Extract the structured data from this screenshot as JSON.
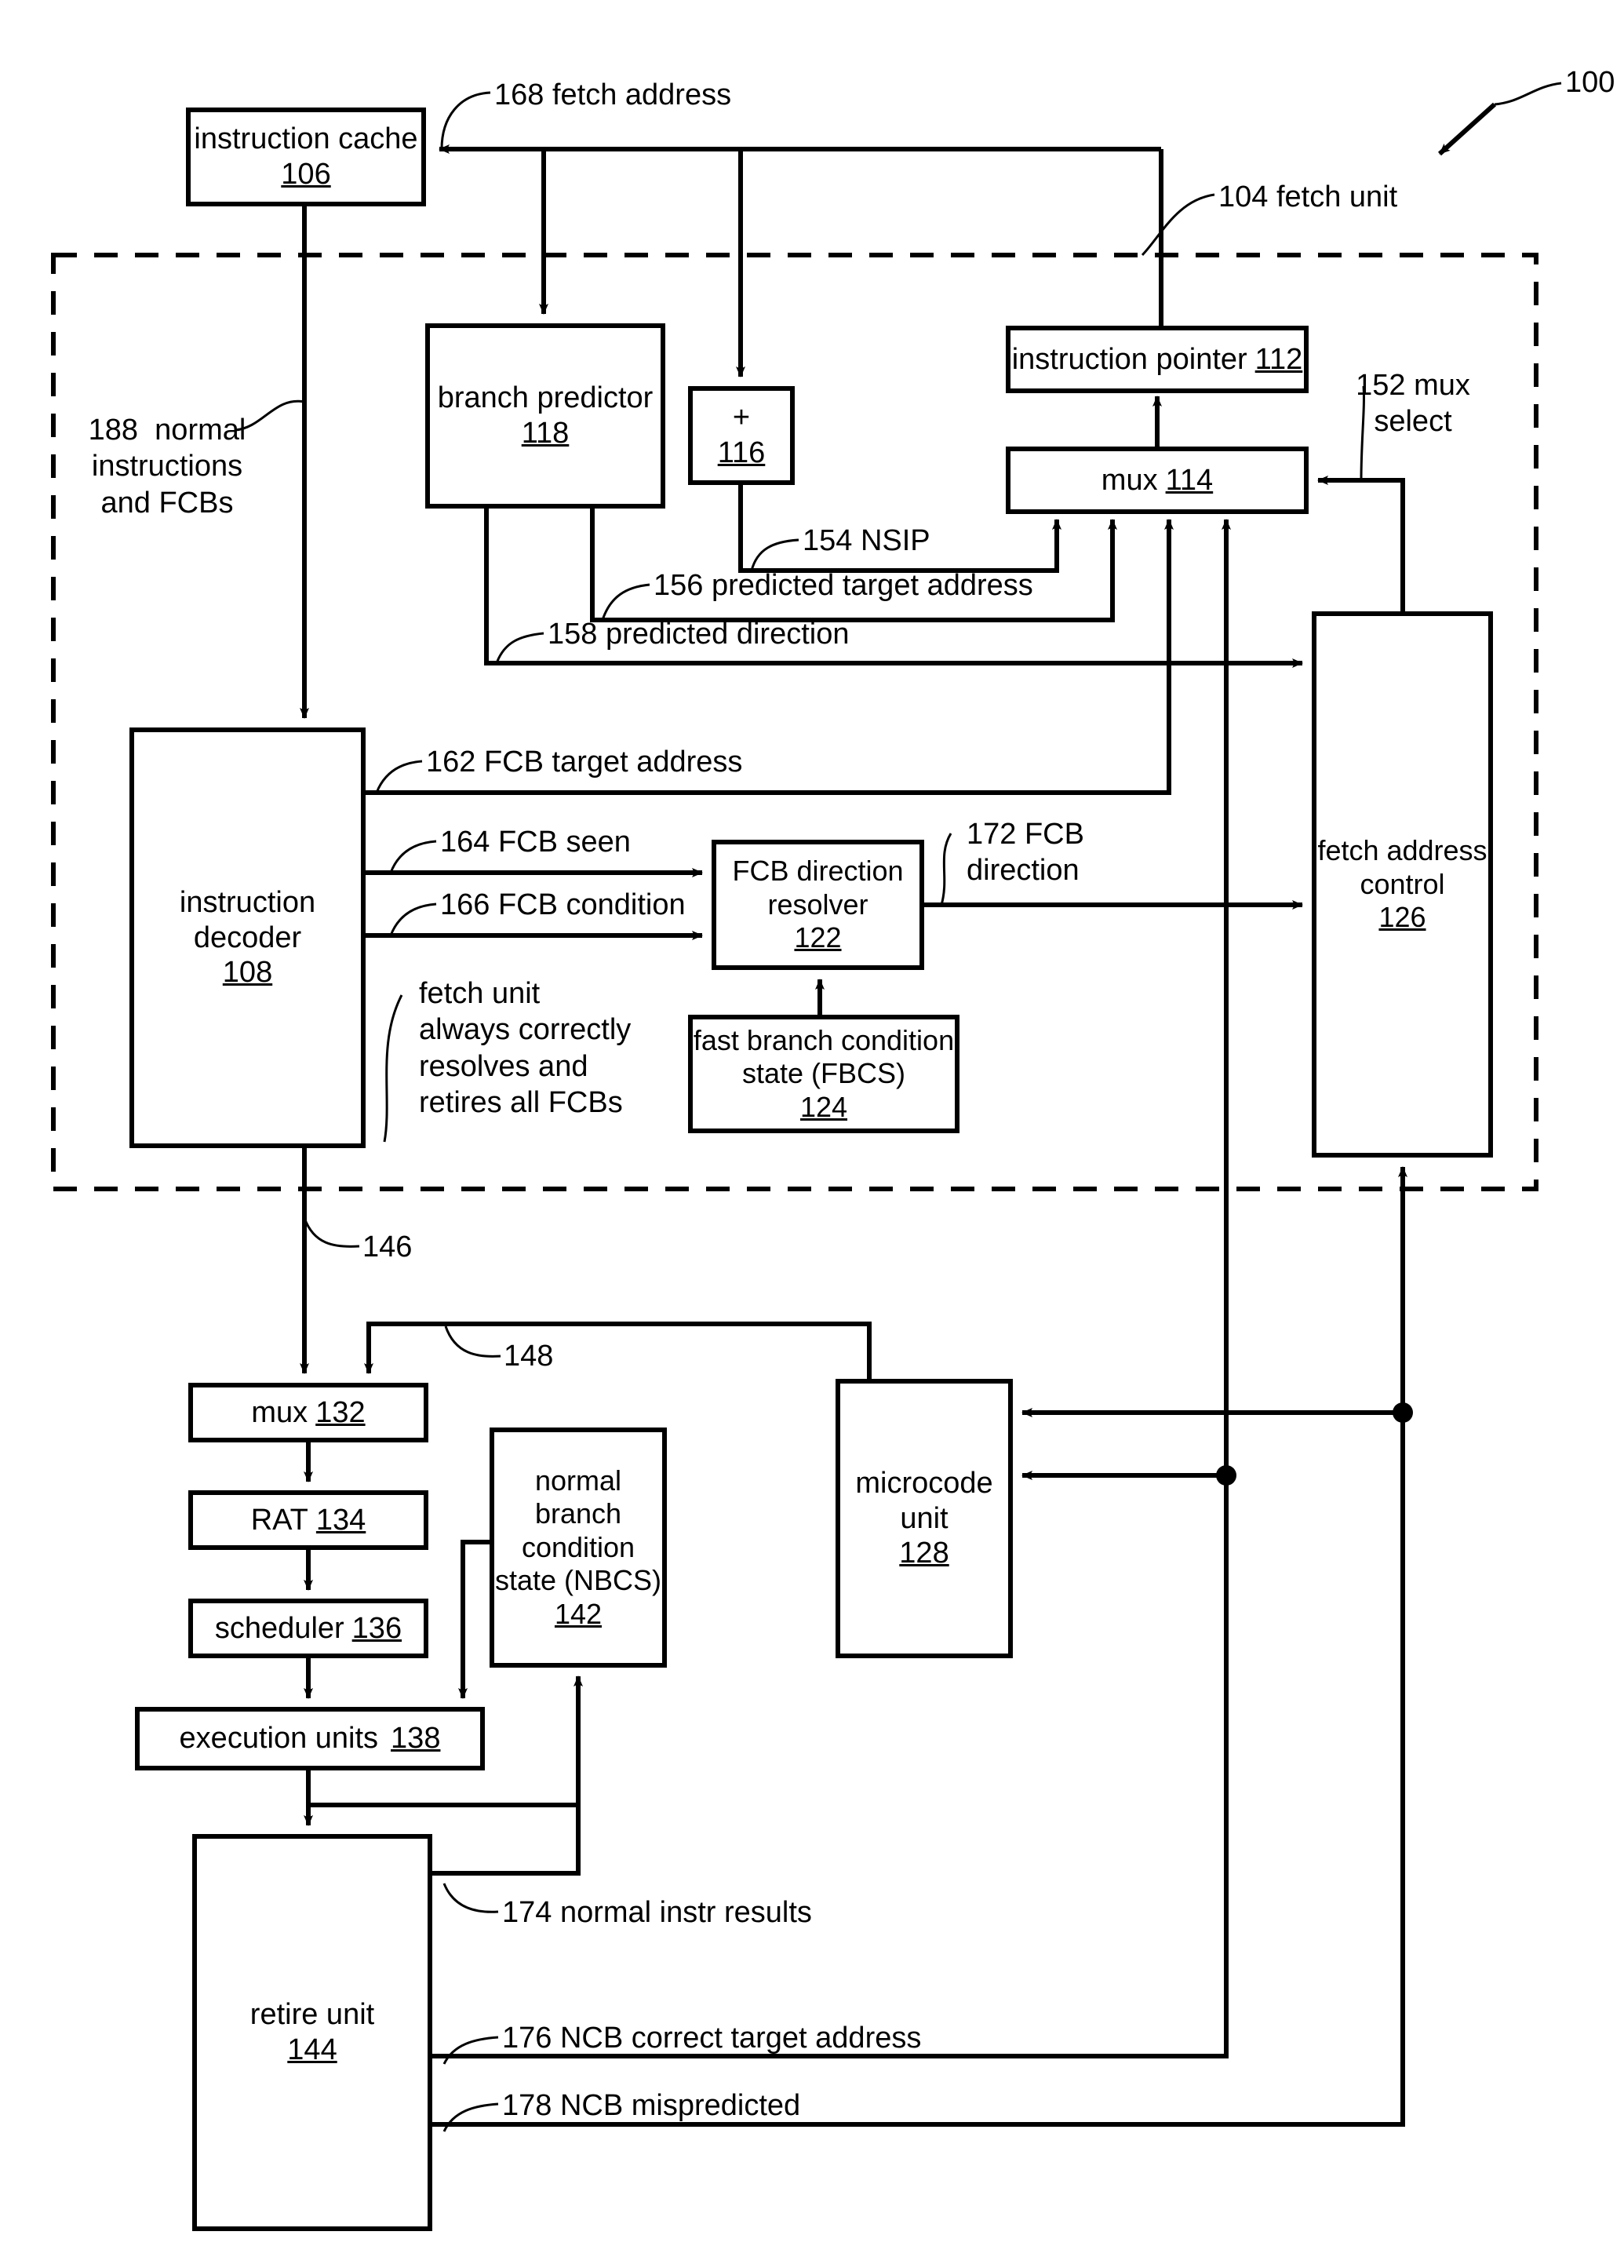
{
  "figure": {
    "figure_number": "100",
    "dashed_region_label": "104 fetch unit"
  },
  "blocks": [
    {
      "id": "instruction_cache",
      "title": "instruction cache",
      "number": "106",
      "inline": false
    },
    {
      "id": "branch_predictor",
      "title": "branch predictor",
      "number": "118",
      "inline": false
    },
    {
      "id": "adder",
      "title": "+",
      "number": "116",
      "inline": false
    },
    {
      "id": "instruction_pointer",
      "title": "instruction pointer",
      "number": "112",
      "inline": true
    },
    {
      "id": "mux_114",
      "title": "mux",
      "number": "114",
      "inline": true
    },
    {
      "id": "instruction_decoder",
      "title": "instruction\ndecoder",
      "number": "108",
      "inline": false
    },
    {
      "id": "fcb_direction_resolver",
      "title": "FCB direction\nresolver",
      "number": "122",
      "inline": true
    },
    {
      "id": "fbcs",
      "title": "fast branch condition\nstate (FBCS)",
      "number": "124",
      "inline": true
    },
    {
      "id": "fetch_address_control",
      "title": "fetch address\ncontrol",
      "number": "126",
      "inline": false
    },
    {
      "id": "mux_132",
      "title": "mux",
      "number": "132",
      "inline": true
    },
    {
      "id": "rat_134",
      "title": "RAT",
      "number": "134",
      "inline": true
    },
    {
      "id": "scheduler_136",
      "title": "scheduler",
      "number": "136",
      "inline": true
    },
    {
      "id": "execution_units",
      "title": "execution units",
      "number": "138",
      "inline": true
    },
    {
      "id": "nbcs",
      "title": "normal\nbranch\ncondition\nstate (NBCS)",
      "number": "142",
      "inline": false
    },
    {
      "id": "microcode_unit",
      "title": "microcode\nunit",
      "number": "128",
      "inline": false
    },
    {
      "id": "retire_unit",
      "title": "retire unit",
      "number": "144",
      "inline": false
    }
  ],
  "signals": [
    {
      "id": "s168",
      "text": "168 fetch address"
    },
    {
      "id": "s104",
      "text": "104 fetch unit"
    },
    {
      "id": "s152",
      "text": "152 mux\nselect"
    },
    {
      "id": "s154",
      "text": "154 NSIP"
    },
    {
      "id": "s156",
      "text": "156 predicted target address"
    },
    {
      "id": "s158",
      "text": "158 predicted direction"
    },
    {
      "id": "s188",
      "text": "188  normal\ninstructions\nand FCBs"
    },
    {
      "id": "s162",
      "text": "162 FCB target address"
    },
    {
      "id": "s164",
      "text": "164 FCB seen"
    },
    {
      "id": "s166",
      "text": "166 FCB condition"
    },
    {
      "id": "s172",
      "text": "172 FCB\ndirection"
    },
    {
      "id": "note146",
      "text": "fetch unit\nalways correctly\nresolves and\nretires all FCBs"
    },
    {
      "id": "s146",
      "text": "146"
    },
    {
      "id": "s148",
      "text": "148"
    },
    {
      "id": "s174",
      "text": "174 normal instr results"
    },
    {
      "id": "s176",
      "text": "176 NCB correct target address"
    },
    {
      "id": "s178",
      "text": "178 NCB mispredicted"
    },
    {
      "id": "s100",
      "text": "100"
    }
  ],
  "colors": {
    "ink": "#000000",
    "paper": "#ffffff"
  }
}
